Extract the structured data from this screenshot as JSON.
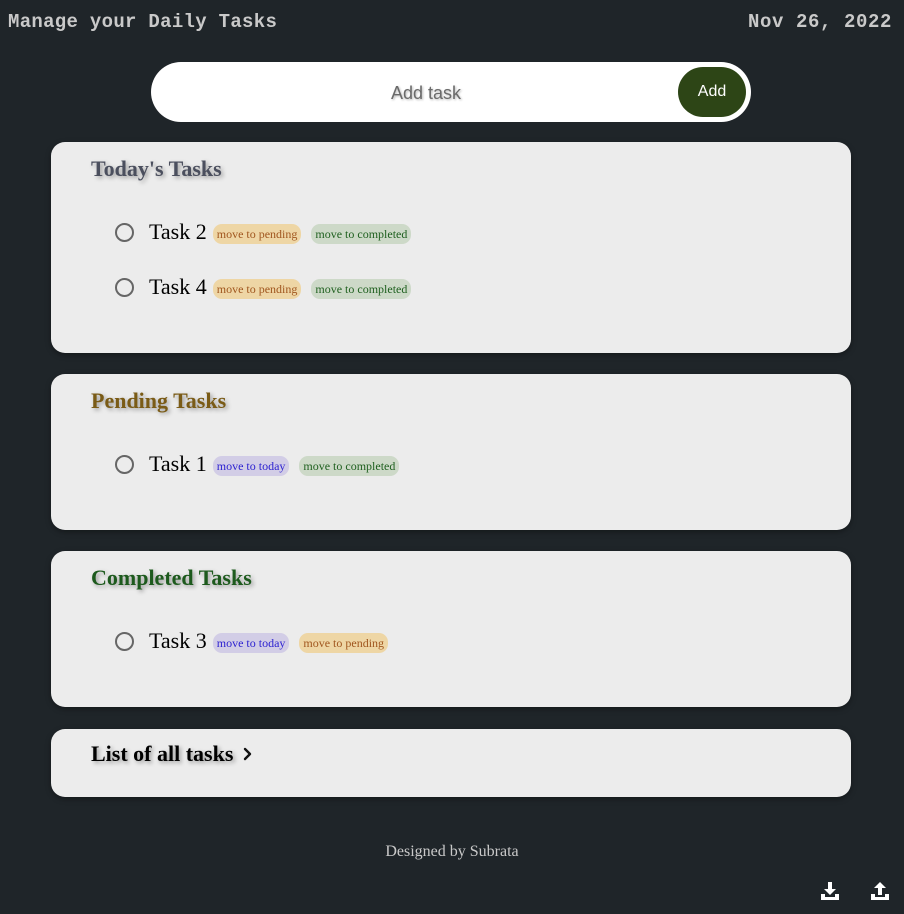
{
  "header": {
    "title": "Manage your Daily Tasks",
    "date": "Nov 26, 2022"
  },
  "add_task": {
    "placeholder": "Add task",
    "value": "",
    "button_label": "Add"
  },
  "sections": {
    "today": {
      "title": "Today's Tasks",
      "tasks": [
        {
          "name": "Task 2",
          "action_1": "move to pending",
          "action_2": "move to completed"
        },
        {
          "name": "Task 4",
          "action_1": "move to pending",
          "action_2": "move to completed"
        }
      ]
    },
    "pending": {
      "title": "Pending Tasks",
      "tasks": [
        {
          "name": "Task 1",
          "action_1": "move to today",
          "action_2": "move to completed"
        }
      ]
    },
    "completed": {
      "title": "Completed Tasks",
      "tasks": [
        {
          "name": "Task 3",
          "action_1": "move to today",
          "action_2": "move to pending"
        }
      ]
    }
  },
  "all_tasks_link": {
    "label": "List of all tasks",
    "icon": "chevron-right-icon"
  },
  "footer": {
    "credit": "Designed by Subrata"
  },
  "icons": {
    "download": "download-icon",
    "upload": "upload-icon"
  },
  "colors": {
    "background": "#1f2529",
    "card": "#ececec",
    "add_button": "#2d4516",
    "today_title": "#4b4f5e",
    "pending_title": "#7a5b16",
    "completed_title": "#1d5a1d",
    "pill_pending_bg": "#eed6a5",
    "pill_completed_bg": "#cdd9c8",
    "pill_today_bg": "#d2cde6"
  }
}
